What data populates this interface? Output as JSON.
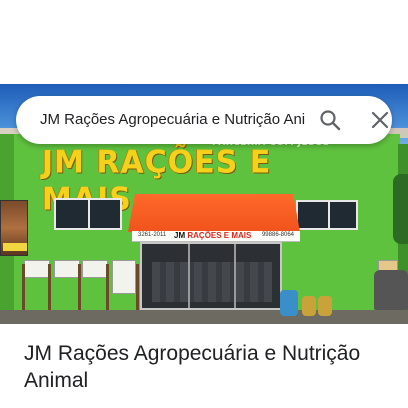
{
  "search": {
    "query": "JM Rações Agropecuária e Nutrição Animal",
    "search_icon": "search-icon",
    "close_icon": "close-icon"
  },
  "photo": {
    "sign_parceria": "PARCERIA COM JESUS",
    "sign_main": "JM RAÇÕES E MAIS",
    "store_sign_name_black": "JM",
    "store_sign_name_red": "RAÇÕES E MAIS",
    "store_sign_phone_left": "3261-2011",
    "store_sign_phone_right": "99886-8064"
  },
  "place": {
    "title": "JM Rações Agropecuária e Nutrição Animal",
    "star_color": "#fbbc04"
  },
  "colors": {
    "wall": "#5fc23e",
    "sign_text": "#f4d21c",
    "awning": "#f0531c"
  }
}
